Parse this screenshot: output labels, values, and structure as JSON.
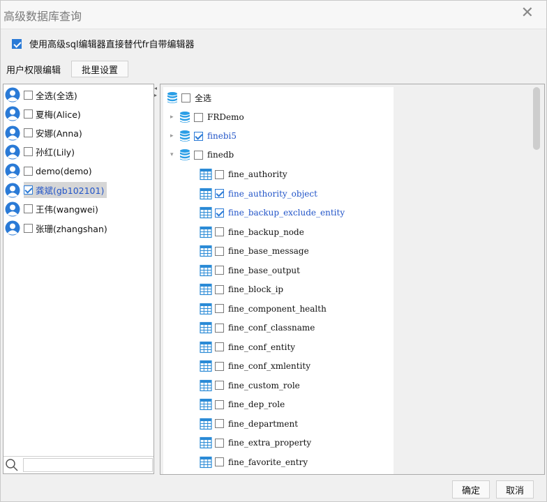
{
  "dialog": {
    "title": "高级数据库查询",
    "close_glyph": "✕"
  },
  "use_sql": {
    "label": "使用高级sql编辑器直接替代fr自带编辑器",
    "checked": true
  },
  "permission": {
    "label": "用户权限编辑",
    "batch_button": "批里设置"
  },
  "users": [
    {
      "label": "全选(全选)",
      "checked": false
    },
    {
      "label": "夏梅(Alice)",
      "checked": false
    },
    {
      "label": "安娜(Anna)",
      "checked": false
    },
    {
      "label": "孙红(Lily)",
      "checked": false
    },
    {
      "label": "demo(demo)",
      "checked": false
    },
    {
      "label": "龚斌(gb102101)",
      "checked": true
    },
    {
      "label": "王伟(wangwei)",
      "checked": false
    },
    {
      "label": "张珊(zhangshan)",
      "checked": false
    }
  ],
  "tree": {
    "root": "全选",
    "databases": [
      {
        "name": "FRDemo",
        "checked": false
      },
      {
        "name": "finebi5",
        "checked": true
      },
      {
        "name": "finedb",
        "checked": false
      }
    ],
    "tables": [
      {
        "name": "fine_authority",
        "checked": false
      },
      {
        "name": "fine_authority_object",
        "checked": true
      },
      {
        "name": "fine_backup_exclude_entity",
        "checked": true
      },
      {
        "name": "fine_backup_node",
        "checked": false
      },
      {
        "name": "fine_base_message",
        "checked": false
      },
      {
        "name": "fine_base_output",
        "checked": false
      },
      {
        "name": "fine_block_ip",
        "checked": false
      },
      {
        "name": "fine_component_health",
        "checked": false
      },
      {
        "name": "fine_conf_classname",
        "checked": false
      },
      {
        "name": "fine_conf_entity",
        "checked": false
      },
      {
        "name": "fine_conf_xmlentity",
        "checked": false
      },
      {
        "name": "fine_custom_role",
        "checked": false
      },
      {
        "name": "fine_dep_role",
        "checked": false
      },
      {
        "name": "fine_department",
        "checked": false
      },
      {
        "name": "fine_extra_property",
        "checked": false
      },
      {
        "name": "fine_favorite_entry",
        "checked": false
      }
    ]
  },
  "buttons": {
    "ok": "确定",
    "cancel": "取消"
  },
  "colors": {
    "accent": "#2a7ad6",
    "selected_text": "#2154c8",
    "selected_bg": "#d6d6d6"
  },
  "icons": {
    "user": "user-avatar-icon",
    "db": "database-icon",
    "table": "table-icon",
    "search": "search-icon"
  }
}
